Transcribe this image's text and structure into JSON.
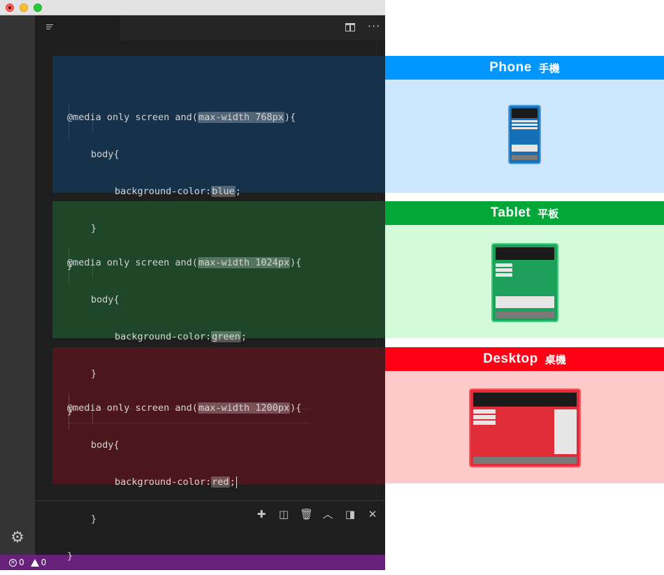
{
  "editor": {
    "blocks": [
      {
        "query_prefix": "@media only screen and(",
        "query_highlight": "max-width 768px",
        "query_suffix": "){",
        "selector": "body{",
        "prop": "background-color:",
        "value": "blue",
        "value_suffix": ";",
        "close_inner": "}",
        "close_outer": "}"
      },
      {
        "query_prefix": "@media only screen and(",
        "query_highlight": "max-width 1024px",
        "query_suffix": "){",
        "selector": "body{",
        "prop": "background-color:",
        "value": "green",
        "value_suffix": ";",
        "close_inner": "}",
        "close_outer": "}"
      },
      {
        "query_prefix": "@media only screen and(",
        "query_highlight": "max-width 1200px",
        "query_suffix": "){",
        "selector": "body{",
        "prop": "background-color:",
        "value": "red",
        "value_suffix": ";",
        "close_inner": "}",
        "close_outer": "}"
      }
    ],
    "block_colors": [
      "#16324a",
      "#1e4729",
      "#4c171c"
    ]
  },
  "statusbar": {
    "errors": "0",
    "warnings": "0",
    "color": "#68217a"
  },
  "devices": [
    {
      "title_en": "Phone",
      "title_zh": "手機",
      "header_color": "#0096ff",
      "body_color": "#cde8fe",
      "icon": "phone-icon"
    },
    {
      "title_en": "Tablet",
      "title_zh": "平板",
      "header_color": "#01a838",
      "body_color": "#d3fad9",
      "icon": "tablet-icon"
    },
    {
      "title_en": "Desktop",
      "title_zh": "桌機",
      "header_color": "#ff0015",
      "body_color": "#fecacc",
      "icon": "desktop-icon"
    }
  ],
  "icons": {
    "tab": "file-lines-icon",
    "split": "split-editor-icon",
    "more": "more-actions-icon",
    "settings": "gear-icon",
    "panel": [
      "plus-icon",
      "split-terminal-icon",
      "trash-icon",
      "chevron-up-icon",
      "toggle-panel-icon",
      "close-icon"
    ]
  }
}
